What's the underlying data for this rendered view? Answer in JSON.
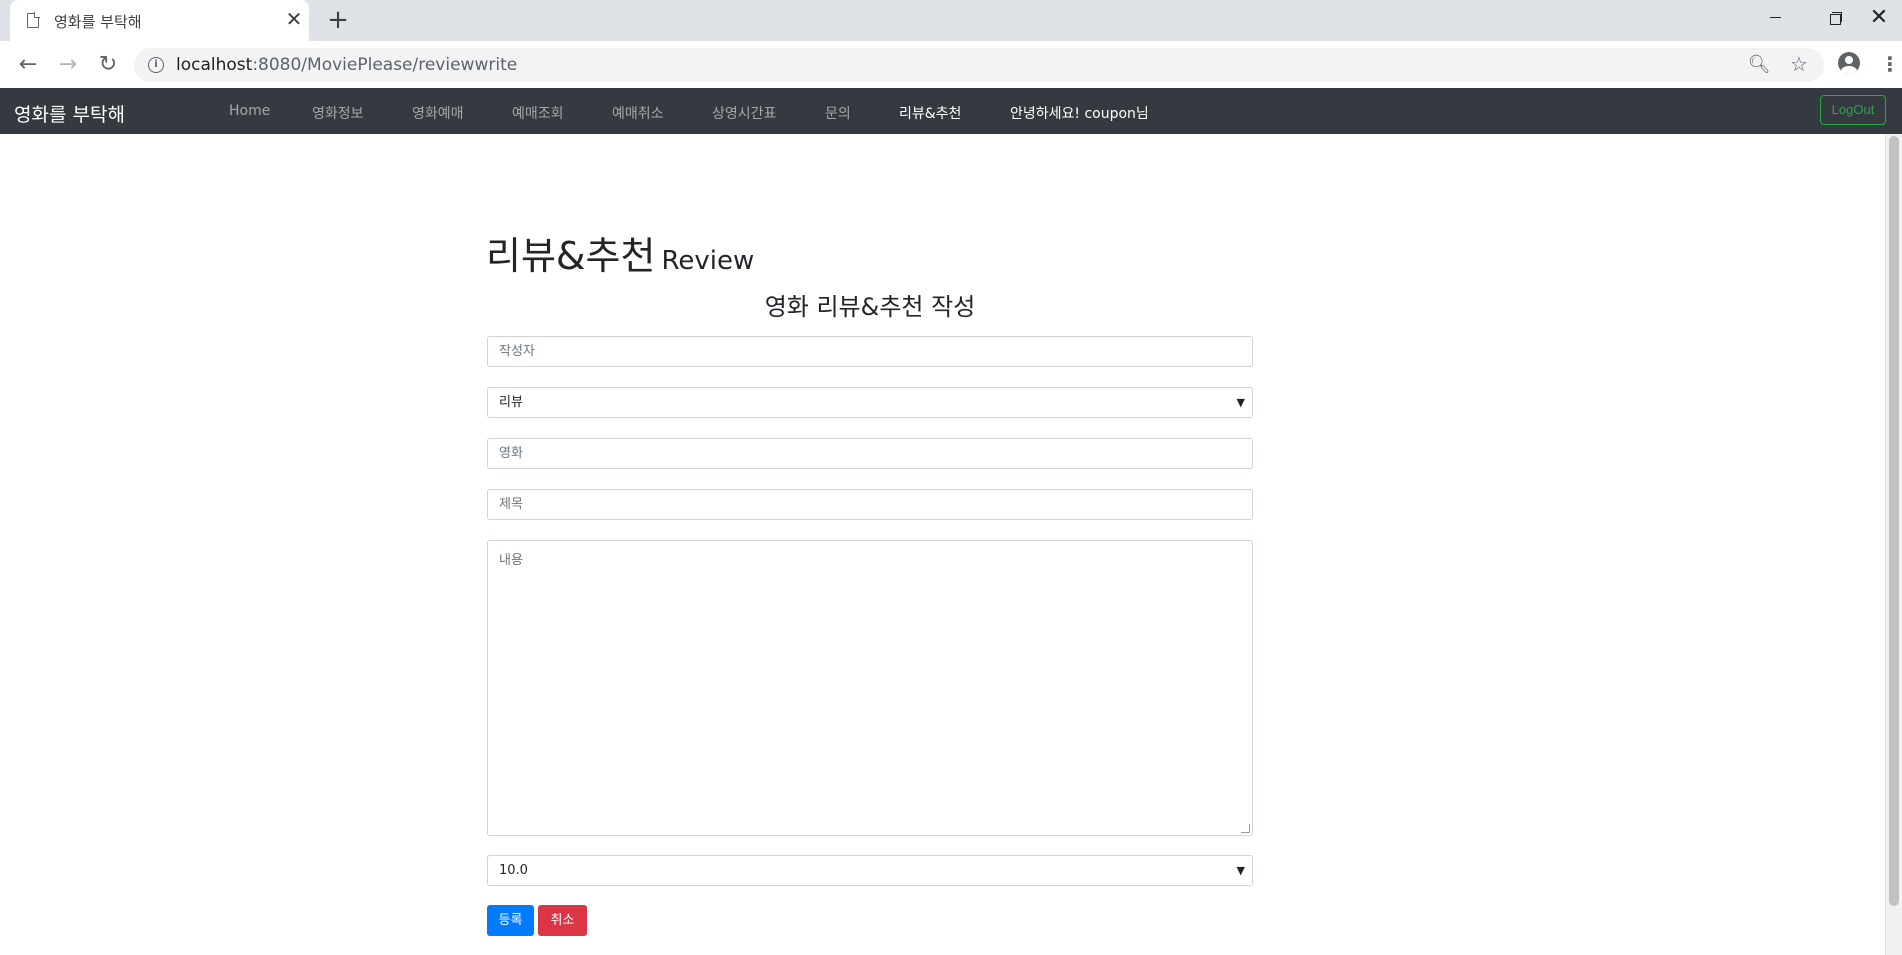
{
  "browser": {
    "tab_title": "영화를 부탁해",
    "url_host": "localhost",
    "url_rest": ":8080/MoviePlease/reviewwrite"
  },
  "navbar": {
    "brand": "영화를 부탁해",
    "items": [
      {
        "label": "Home"
      },
      {
        "label": "영화정보"
      },
      {
        "label": "영화예매"
      },
      {
        "label": "예매조회"
      },
      {
        "label": "예매취소"
      },
      {
        "label": "상영시간표"
      },
      {
        "label": "문의"
      },
      {
        "label": "리뷰&추천"
      }
    ],
    "greeting": "안녕하세요! coupon님",
    "logout": "LogOut"
  },
  "page": {
    "heading": "리뷰&추천",
    "heading_sub": "Review",
    "form_title": "영화 리뷰&추천 작성"
  },
  "form": {
    "author_placeholder": "작성자",
    "type_selected": "리뷰",
    "movie_placeholder": "영화",
    "title_placeholder": "제목",
    "content_placeholder": "내용",
    "rating_selected": "10.0",
    "submit": "등록",
    "cancel": "취소"
  },
  "colors": {
    "navbar_bg": "#343a40",
    "primary": "#007bff",
    "danger": "#dc3545",
    "success": "#28a745"
  }
}
